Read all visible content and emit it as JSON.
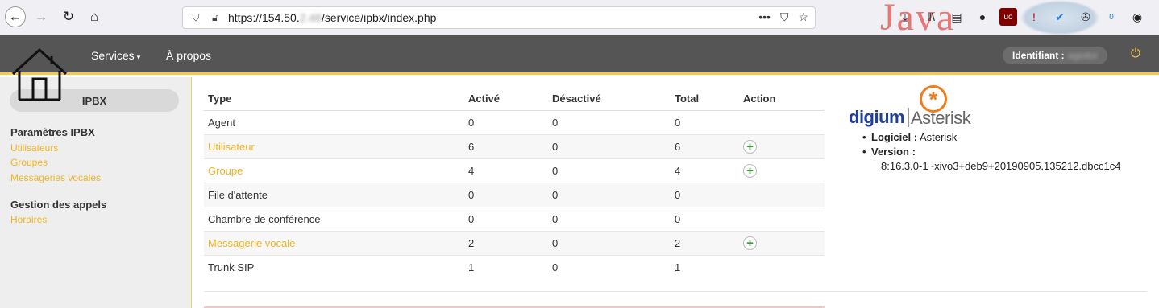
{
  "browser": {
    "url_prefix": "https://154.50.",
    "url_blur": "2.46",
    "url_suffix": "/service/ipbx/index.php",
    "overlay_logo_text": "Java",
    "ublock_label": "uo",
    "badge_count": "0"
  },
  "header": {
    "services_label": "Services",
    "apropos_label": "À propos",
    "user_label": "Identifiant :",
    "user_value": "agedor"
  },
  "sidebar": {
    "pill_label": "IPBX",
    "section1_title": "Paramètres IPBX",
    "section1_links": [
      "Utilisateurs",
      "Groupes",
      "Messageries vocales"
    ],
    "section2_title": "Gestion des appels",
    "section2_links": [
      "Horaires"
    ]
  },
  "table": {
    "headers": [
      "Type",
      "Activé",
      "Désactivé",
      "Total",
      "Action"
    ],
    "rows": [
      {
        "type": "Agent",
        "active": "0",
        "disabled": "0",
        "total": "0",
        "link": false,
        "action": false
      },
      {
        "type": "Utilisateur",
        "active": "6",
        "disabled": "0",
        "total": "6",
        "link": true,
        "action": true
      },
      {
        "type": "Groupe",
        "active": "4",
        "disabled": "0",
        "total": "4",
        "link": true,
        "action": true
      },
      {
        "type": "File d'attente",
        "active": "0",
        "disabled": "0",
        "total": "0",
        "link": false,
        "action": false
      },
      {
        "type": "Chambre de conférence",
        "active": "0",
        "disabled": "0",
        "total": "0",
        "link": false,
        "action": false
      },
      {
        "type": "Messagerie vocale",
        "active": "2",
        "disabled": "0",
        "total": "2",
        "link": true,
        "action": true
      },
      {
        "type": "Trunk SIP",
        "active": "1",
        "disabled": "0",
        "total": "1",
        "link": false,
        "action": false
      }
    ]
  },
  "info": {
    "brand_digium": "digium",
    "brand_asterisk": "Asterisk",
    "software_label": "Logiciel :",
    "software_value": "Asterisk",
    "version_label": "Version :",
    "version_value": "8:16.3.0-1~xivo3+deb9+20190905.135212.dbcc1c4"
  },
  "colors": {
    "accent_yellow": "#f7c948",
    "link_yellow": "#f0b523",
    "header_gray": "#555555",
    "plus_green": "#3a9a3a"
  }
}
